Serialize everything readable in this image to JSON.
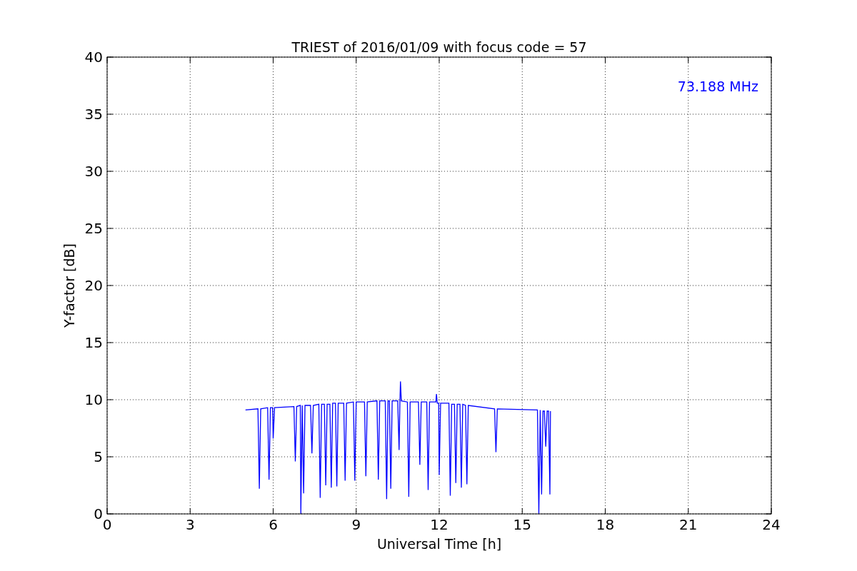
{
  "chart": {
    "chart_data": {
      "type": "line",
      "title": "TRIEST of 2016/01/09 with focus code = 57",
      "xlabel": "Universal Time [h]",
      "ylabel": "Y-factor [dB]",
      "xlim": [
        0,
        24
      ],
      "ylim": [
        0,
        40
      ],
      "xticks": [
        0,
        3,
        6,
        9,
        12,
        15,
        18,
        21,
        24
      ],
      "yticks": [
        0,
        5,
        10,
        15,
        20,
        25,
        30,
        35,
        40
      ],
      "x": [
        5.0,
        5.45,
        5.5,
        5.55,
        5.8,
        5.85,
        5.9,
        5.98,
        6.0,
        6.05,
        6.75,
        6.8,
        6.85,
        6.98,
        7.0,
        7.05,
        7.1,
        7.15,
        7.35,
        7.4,
        7.45,
        7.65,
        7.7,
        7.75,
        7.85,
        7.9,
        7.95,
        8.05,
        8.1,
        8.15,
        8.25,
        8.3,
        8.35,
        8.55,
        8.6,
        8.65,
        8.9,
        8.95,
        9.0,
        9.3,
        9.35,
        9.4,
        9.75,
        9.8,
        9.85,
        10.05,
        10.1,
        10.15,
        10.2,
        10.25,
        10.3,
        10.5,
        10.55,
        10.58,
        10.6,
        10.63,
        10.85,
        10.9,
        10.95,
        11.25,
        11.3,
        11.35,
        11.55,
        11.6,
        11.65,
        11.88,
        11.9,
        11.93,
        11.98,
        12.0,
        12.05,
        12.35,
        12.4,
        12.45,
        12.55,
        12.6,
        12.65,
        12.75,
        12.8,
        12.85,
        12.95,
        13.0,
        13.05,
        14.0,
        14.05,
        14.1,
        15.55,
        15.6,
        15.65,
        15.7,
        15.75,
        15.8,
        15.85,
        15.9,
        15.95,
        16.0,
        16.02
      ],
      "series": [
        {
          "color": "#0000ff",
          "values": [
            9.1,
            9.2,
            2.2,
            9.2,
            9.3,
            3.0,
            9.3,
            9.3,
            6.6,
            9.3,
            9.4,
            4.6,
            9.4,
            9.5,
            0,
            9.5,
            1.8,
            9.5,
            9.5,
            5.3,
            9.5,
            9.6,
            1.4,
            9.6,
            9.6,
            2.5,
            9.6,
            9.6,
            2.3,
            9.7,
            9.7,
            2.4,
            9.7,
            9.7,
            2.9,
            9.7,
            9.8,
            2.9,
            9.8,
            9.8,
            3.3,
            9.8,
            9.9,
            3.0,
            9.9,
            9.9,
            1.3,
            9.9,
            9.9,
            2.2,
            9.9,
            9.9,
            5.6,
            9.9,
            11.6,
            9.9,
            9.8,
            1.5,
            9.8,
            9.8,
            4.3,
            9.8,
            9.8,
            2.1,
            9.8,
            9.8,
            10.5,
            9.7,
            9.7,
            3.4,
            9.7,
            9.7,
            1.6,
            9.6,
            9.6,
            2.7,
            9.6,
            9.6,
            2.3,
            9.6,
            9.5,
            2.6,
            9.5,
            9.2,
            5.4,
            9.2,
            9.1,
            0,
            9.1,
            1.7,
            9.0,
            9.0,
            5.9,
            9.0,
            9.0,
            1.7,
            9.0
          ]
        }
      ],
      "grid": true,
      "annotations": [
        "73.188 MHz"
      ]
    }
  }
}
